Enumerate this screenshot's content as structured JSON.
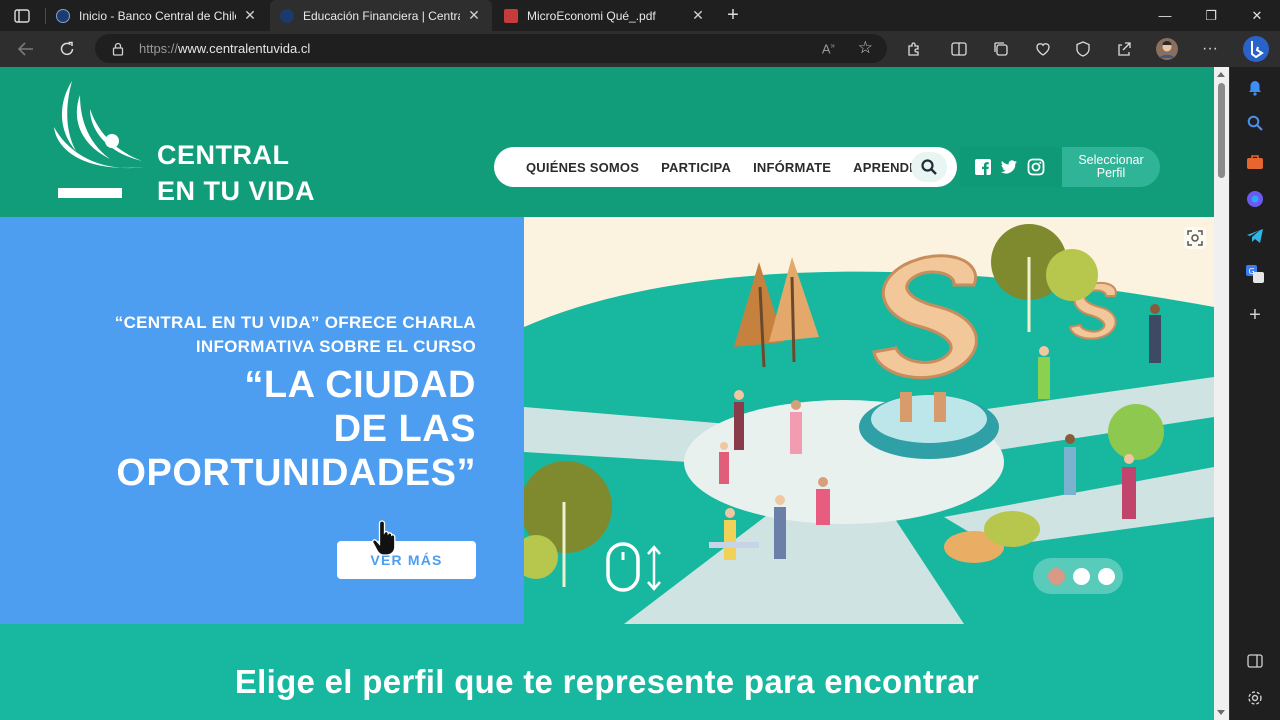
{
  "browser": {
    "tabs": [
      {
        "title": "Inicio - Banco Central de Chile",
        "active": false
      },
      {
        "title": "Educación Financiera | Central en",
        "active": true
      },
      {
        "title": "MicroEconomi Qué_.pdf",
        "active": false
      }
    ],
    "address": {
      "scheme": "https://",
      "host": "www.centralentuvida.cl"
    },
    "toolbar_icons": [
      "back-icon",
      "refresh-icon",
      "lock-icon",
      "read-aloud-icon",
      "favorite-star-icon",
      "extensions-icon",
      "split-screen-icon",
      "collections-icon",
      "performance-icon",
      "browser-essentials-icon",
      "share-icon",
      "profile-avatar",
      "more-icon",
      "bing-copilot-icon"
    ],
    "sidebar_icons": [
      "bell-icon",
      "search-icon",
      "shopping-icon",
      "copilot-icon",
      "telegram-icon",
      "translate-icon",
      "add-icon",
      "sidebar-toggle-icon",
      "settings-icon"
    ]
  },
  "site": {
    "logo_line1": "CENTRAL",
    "logo_line2": "EN TU VIDA",
    "nav": [
      "QUIÉNES SOMOS",
      "PARTICIPA",
      "INFÓRMATE",
      "APRENDE"
    ],
    "profile_line1": "Seleccionar",
    "profile_line2": "Perfil",
    "hero": {
      "subtitle_line1": "“CENTRAL EN TU VIDA” OFRECE CHARLA",
      "subtitle_line2": "INFORMATIVA SOBRE EL CURSO",
      "title_line1": "“LA CIUDAD",
      "title_line2": "DE LAS",
      "title_line3": "OPORTUNIDADES”",
      "cta": "VER MÁS"
    },
    "bottom_heading": "Elige el perfil que te represente para encontrar"
  },
  "colors": {
    "header_green": "#119d79",
    "hero_blue": "#4d9df0",
    "teal": "#18b8a0",
    "dot_active": "#d99a85"
  }
}
